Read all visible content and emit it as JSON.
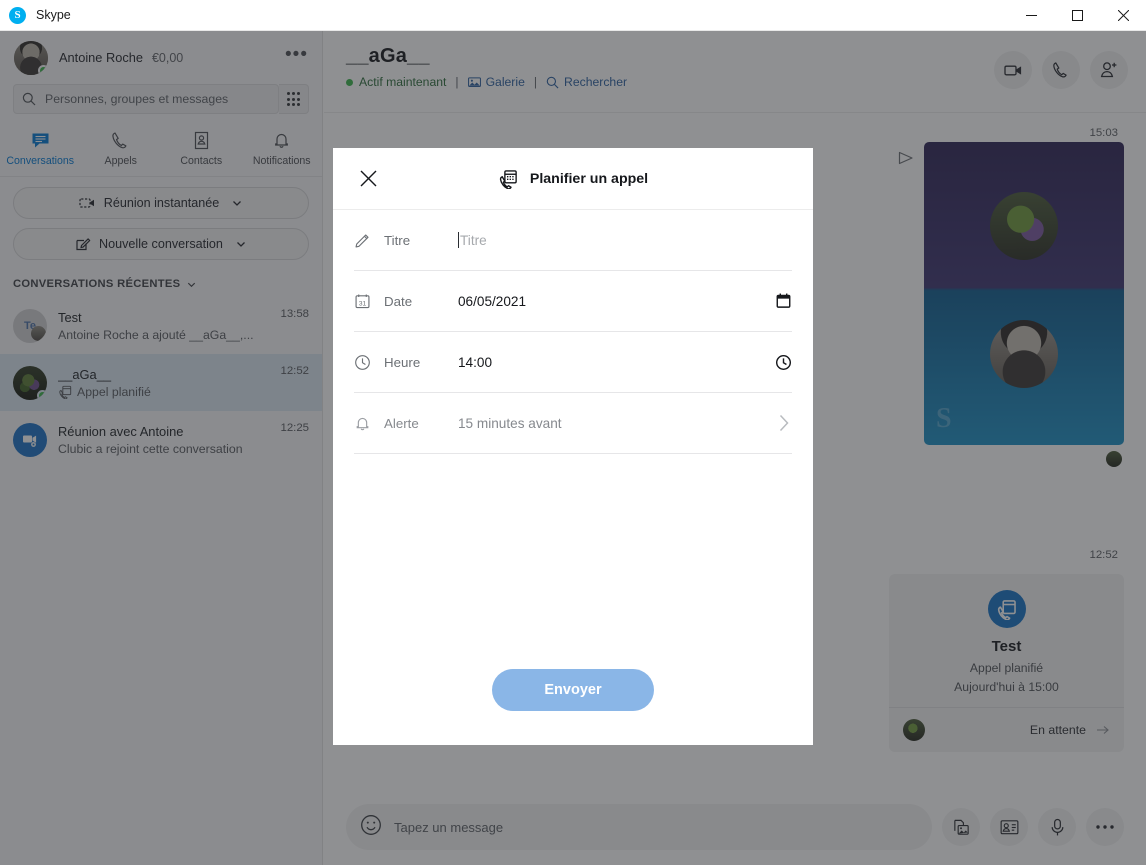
{
  "window": {
    "title": "Skype",
    "logo_icon": "skype-logo-icon",
    "minimize_icon": "minimize-icon",
    "maximize_icon": "maximize-icon",
    "close_icon": "close-icon"
  },
  "sidebar": {
    "profile": {
      "name": "Antoine Roche",
      "balance": "€0,00",
      "more_icon": "more-horizontal-icon",
      "avatar_icon": "user-avatar",
      "presence": "online"
    },
    "search": {
      "placeholder": "Personnes, groupes et messages",
      "icon": "search-icon",
      "dialpad_icon": "dialpad-icon"
    },
    "tabs": [
      {
        "label": "Conversations",
        "icon": "chat-icon",
        "active": true
      },
      {
        "label": "Appels",
        "icon": "phone-icon",
        "active": false
      },
      {
        "label": "Contacts",
        "icon": "contacts-icon",
        "active": false
      },
      {
        "label": "Notifications",
        "icon": "bell-icon",
        "active": false
      }
    ],
    "actions": [
      {
        "label": "Réunion instantanée",
        "icon": "video-camera-icon",
        "chevron": "chevron-down-icon"
      },
      {
        "label": "Nouvelle conversation",
        "icon": "compose-icon",
        "chevron": "chevron-down-icon"
      }
    ],
    "recents_header": "CONVERSATIONS RÉCENTES",
    "recents_chevron": "chevron-down-icon",
    "conversations": [
      {
        "title": "Test",
        "subtitle": "Antoine Roche a ajouté __aGa__,...",
        "time": "13:58",
        "avatar_initials": "Te",
        "selected": false
      },
      {
        "title": "__aGa__",
        "subtitle": "Appel planifié",
        "subtitle_icon": "scheduled-call-icon",
        "time": "12:52",
        "selected": true
      },
      {
        "title": "Réunion avec Antoine",
        "subtitle": "Clubic a rejoint cette conversation",
        "time": "12:25",
        "avatar_icon": "meeting-icon",
        "selected": false
      }
    ]
  },
  "chat": {
    "title": "__aGa__",
    "status": "Actif maintenant",
    "separator": "|",
    "gallery": "Galerie",
    "gallery_icon": "gallery-icon",
    "search": "Rechercher",
    "search_icon": "search-icon",
    "header_actions": [
      {
        "icon": "video-call-icon"
      },
      {
        "icon": "audio-call-icon"
      },
      {
        "icon": "add-person-icon"
      }
    ],
    "messages": [
      {
        "time": "15:03",
        "type": "photo",
        "send_icon": "sent-arrow-icon"
      },
      {
        "time": "12:52",
        "type": "scheduled-call-card",
        "card_icon": "scheduled-call-icon",
        "title": "Test",
        "subtitle": "Appel planifié",
        "when": "Aujourd'hui à 15:00",
        "status": "En attente",
        "status_arrow": "chevron-right-icon"
      }
    ],
    "composer": {
      "placeholder": "Tapez un message",
      "emoji_icon": "emoji-icon",
      "buttons": [
        {
          "icon": "image-icon"
        },
        {
          "icon": "contact-card-icon"
        },
        {
          "icon": "microphone-icon"
        },
        {
          "icon": "more-horizontal-icon"
        }
      ]
    }
  },
  "modal": {
    "close_icon": "close-icon",
    "title": "Planifier un appel",
    "title_icon": "scheduled-call-icon",
    "fields": [
      {
        "label": "Titre",
        "value": "",
        "placeholder": "Titre",
        "icon": "pencil-icon",
        "trailing_icon": "",
        "muted": false
      },
      {
        "label": "Date",
        "value": "06/05/2021",
        "icon": "calendar-day-icon",
        "trailing_icon": "calendar-icon",
        "muted": false
      },
      {
        "label": "Heure",
        "value": "14:00",
        "icon": "clock-icon",
        "trailing_icon": "clock-icon",
        "muted": false
      },
      {
        "label": "Alerte",
        "value": "15 minutes avant",
        "icon": "bell-icon",
        "trailing_icon": "chevron-right-icon",
        "muted": true
      }
    ],
    "submit_label": "Envoyer"
  },
  "colors": {
    "accent": "#0078d4",
    "skype_blue": "#00aff0",
    "presence_green": "#39b54a",
    "selected_row": "#d9e7f0",
    "submit_button": "#8ab6e7",
    "scrim": "#282a2e"
  }
}
